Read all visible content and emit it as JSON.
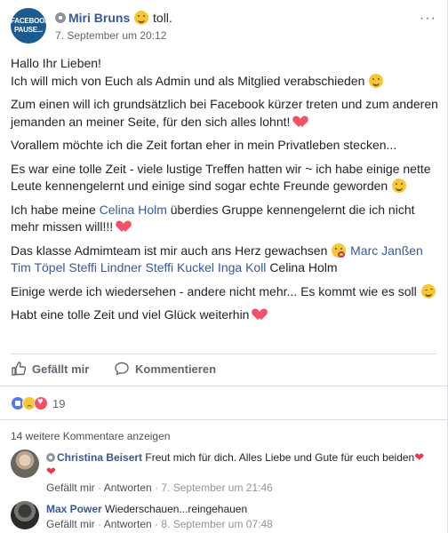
{
  "post": {
    "avatar_text_line1": "FACEBOOK",
    "avatar_text_line2": "PAUSE...",
    "author": "Miri Bruns",
    "feeling": "toll.",
    "timestamp": "7. September um 20:12",
    "more": "···"
  },
  "body": {
    "p1_line1": "Hallo Ihr Lieben!",
    "p1_line2": "Ich will mich von Euch als Admin und als Mitglied verabschieden",
    "p2": "Zum einen will ich grundsätzlich bei Facebook kürzer treten und zum anderen jemanden an meiner Seite, für den sich alles lohnt!",
    "p3": "Vorallem möchte ich die Zeit fortan eher in mein Privatleben stecken...",
    "p4": "Es war eine tolle Zeit - viele lustige Treffen hatten wir ~ ich habe einige nette Leute kennengelernt und einige sind sogar echte Freunde geworden",
    "p5_before": "Ich habe meine ",
    "p5_mention": "Celina Holm",
    "p5_after": " überdies Gruppe kennengelernt die ich nicht mehr missen will!!!",
    "p6_before": "Das klasse Admimteam ist mir auch ans Herz gewachsen",
    "p6_mentions": "Marc Janßen Tim Töpel Steffi Lindner Steffi Kuckel Inga Koll",
    "p6_after": "Celina Holm",
    "p7": "Einige werde ich wiedersehen - andere nicht mehr... Es kommt wie es soll",
    "p8": "Habt eine tolle Zeit und viel Glück weiterhin"
  },
  "actions": {
    "like": "Gefällt mir",
    "comment": "Kommentieren"
  },
  "reactions": {
    "count": "19"
  },
  "more_comments": "14 weitere Kommentare anzeigen",
  "comments": [
    {
      "author": "Christina Beisert",
      "text": "Freut mich für dich. Alles Liebe und Gute für euch beiden",
      "hearts": "❤❤",
      "like": "Gefällt mir",
      "reply": "Antworten",
      "time": "7. September um 21:46"
    },
    {
      "author": "Max Power",
      "text": "Wiederschauen...reingehauen",
      "like": "Gefällt mir",
      "reply": "Antworten",
      "time": "8. September um 07:48"
    }
  ],
  "colors": {
    "link": "#365899",
    "secondary": "#616770",
    "divider": "#dadde1"
  }
}
